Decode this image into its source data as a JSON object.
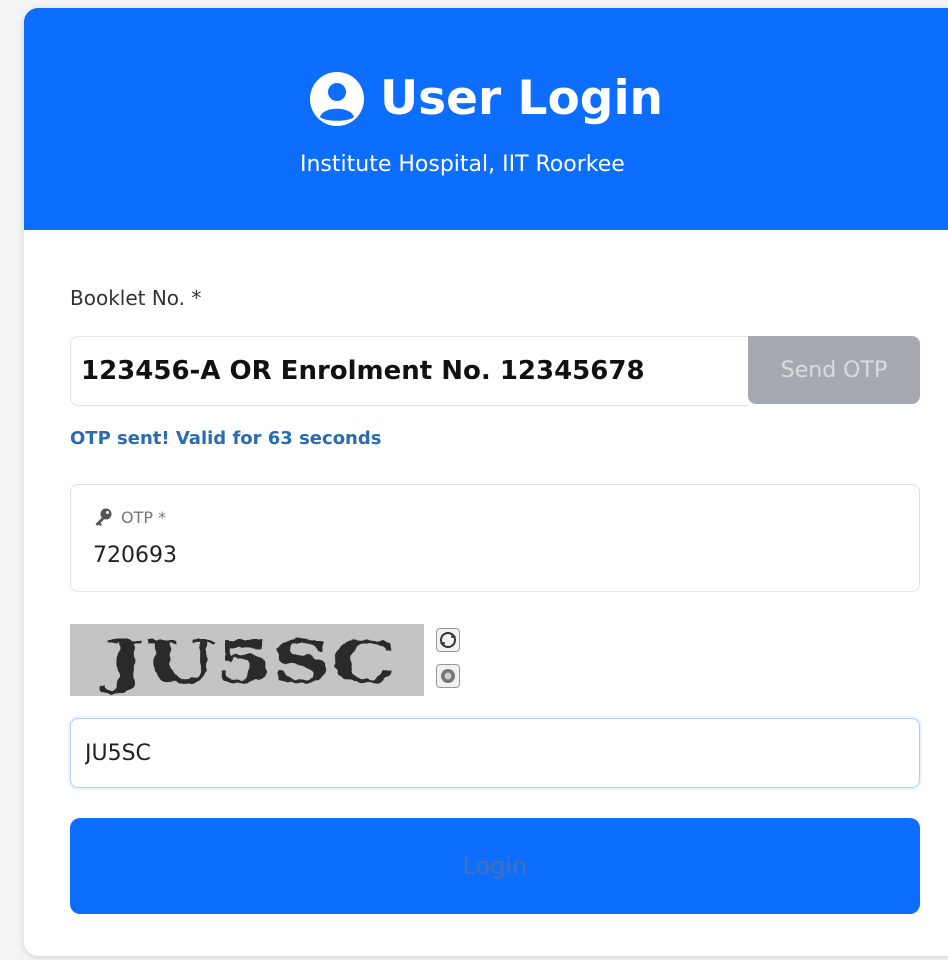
{
  "header": {
    "title": "User Login",
    "subtitle": "Institute Hospital, IIT Roorkee",
    "icon": "user-circle-icon",
    "background_color": "#0d6efd"
  },
  "booklet": {
    "label": "Booklet No. *",
    "value": "123456-A OR Enrolment No. 12345678",
    "send_otp_label": "Send OTP",
    "status_text": "OTP sent! Valid for 63 seconds"
  },
  "otp": {
    "icon": "key-icon",
    "label": "OTP *",
    "value": "720693"
  },
  "captcha": {
    "image_text": "JU5SC",
    "refresh_icon": "refresh-icon",
    "audio_icon": "audio-icon",
    "input_value": "JU5SC"
  },
  "login": {
    "button_label": "Login",
    "button_color": "#0d6efd"
  }
}
